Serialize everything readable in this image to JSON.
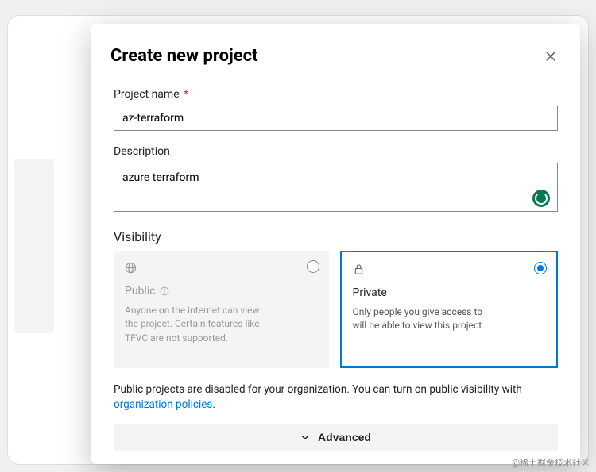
{
  "modal": {
    "title": "Create new project",
    "project_name": {
      "label": "Project name",
      "required_marker": "*",
      "value": "az-terraform"
    },
    "description": {
      "label": "Description",
      "value": "azure terraform"
    },
    "visibility": {
      "label": "Visibility",
      "public": {
        "title": "Public",
        "desc": "Anyone on the internet can view the project. Certain features like TFVC are not supported.",
        "selected": false
      },
      "private": {
        "title": "Private",
        "desc": "Only people you give access to will be able to view this project.",
        "selected": true
      }
    },
    "hint": {
      "text_before": "Public projects are disabled for your organization. You can turn on public visibility with ",
      "link_text": "organization policies",
      "text_after": "."
    },
    "advanced_label": "Advanced"
  },
  "watermark": "@稀土掘金技术社区"
}
